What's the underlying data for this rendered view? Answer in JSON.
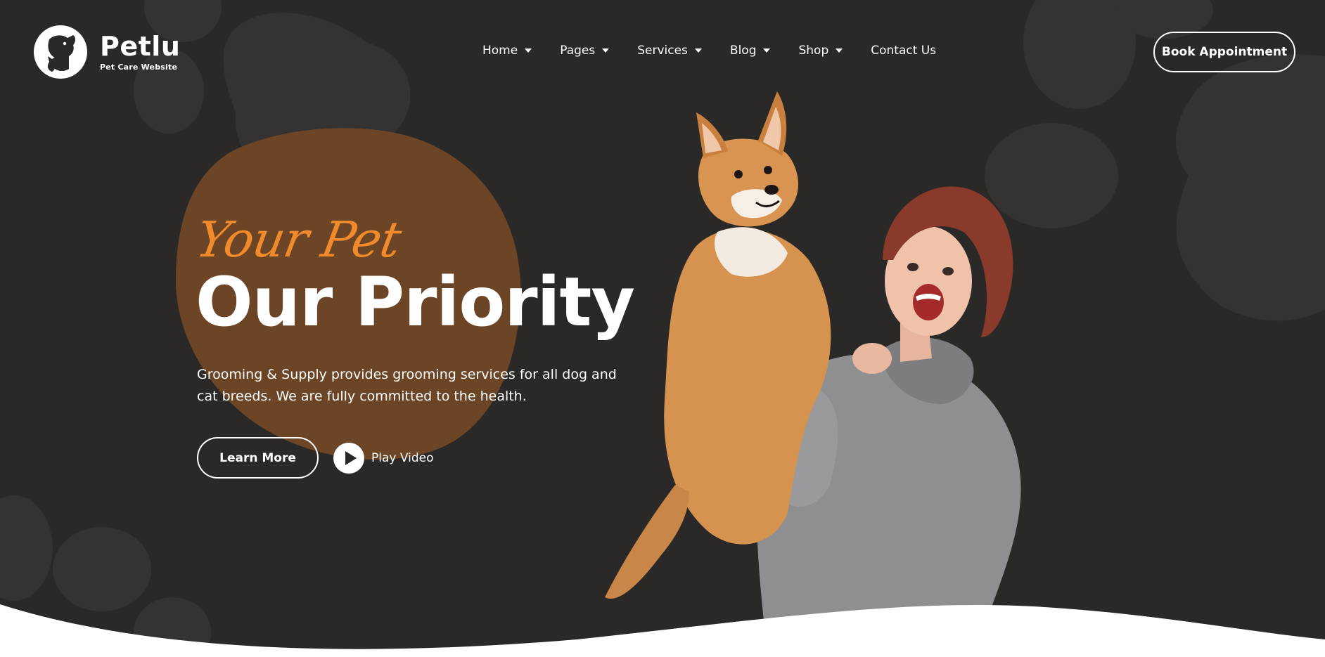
{
  "brand": {
    "name": "Petlu",
    "tagline": "Pet Care Website",
    "logo_icon": "dog-cat-logo-icon"
  },
  "nav": {
    "items": [
      {
        "label": "Home",
        "has_dropdown": true
      },
      {
        "label": "Pages",
        "has_dropdown": true
      },
      {
        "label": "Services",
        "has_dropdown": true
      },
      {
        "label": "Blog",
        "has_dropdown": true
      },
      {
        "label": "Shop",
        "has_dropdown": true
      },
      {
        "label": "Contact Us",
        "has_dropdown": false
      }
    ],
    "cta_label": "Book Appointment"
  },
  "hero": {
    "script_text": "Your Pet",
    "headline": "Our Priority",
    "description": "Grooming & Supply provides grooming services for all dog and cat breeds. We are fully committed to the health.",
    "primary_button": "Learn More",
    "video_button": "Play Video",
    "image_alt_icon": "woman-holding-corgi-photo"
  },
  "colors": {
    "background": "#2b2927",
    "blob_accent": "#6b4526",
    "script_accent": "#f08a2b",
    "paw_shapes": "#353331",
    "text": "#ffffff"
  }
}
